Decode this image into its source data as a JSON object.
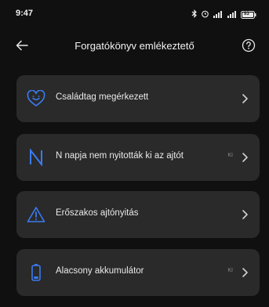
{
  "status_bar": {
    "time": "9:47",
    "battery_level": "93"
  },
  "header": {
    "title": "Forgatókönyv emlékeztető",
    "back_icon": "arrow-left-icon",
    "help_icon": "question-circle-icon"
  },
  "items": [
    {
      "label": "Családtag megérkezett",
      "icon": "heart-smile-icon",
      "state": ""
    },
    {
      "label": "N napja nem nyitották ki az ajtót",
      "icon": "letter-n-icon",
      "state": "KI"
    },
    {
      "label": "Erőszakos ajtónyitás",
      "icon": "warning-triangle-icon",
      "state": ""
    },
    {
      "label": "Alacsony akkumulátor",
      "icon": "battery-low-icon",
      "state": "KI"
    }
  ],
  "colors": {
    "background": "#101010",
    "card": "#2a2a2a",
    "accent": "#3a7bf0"
  }
}
